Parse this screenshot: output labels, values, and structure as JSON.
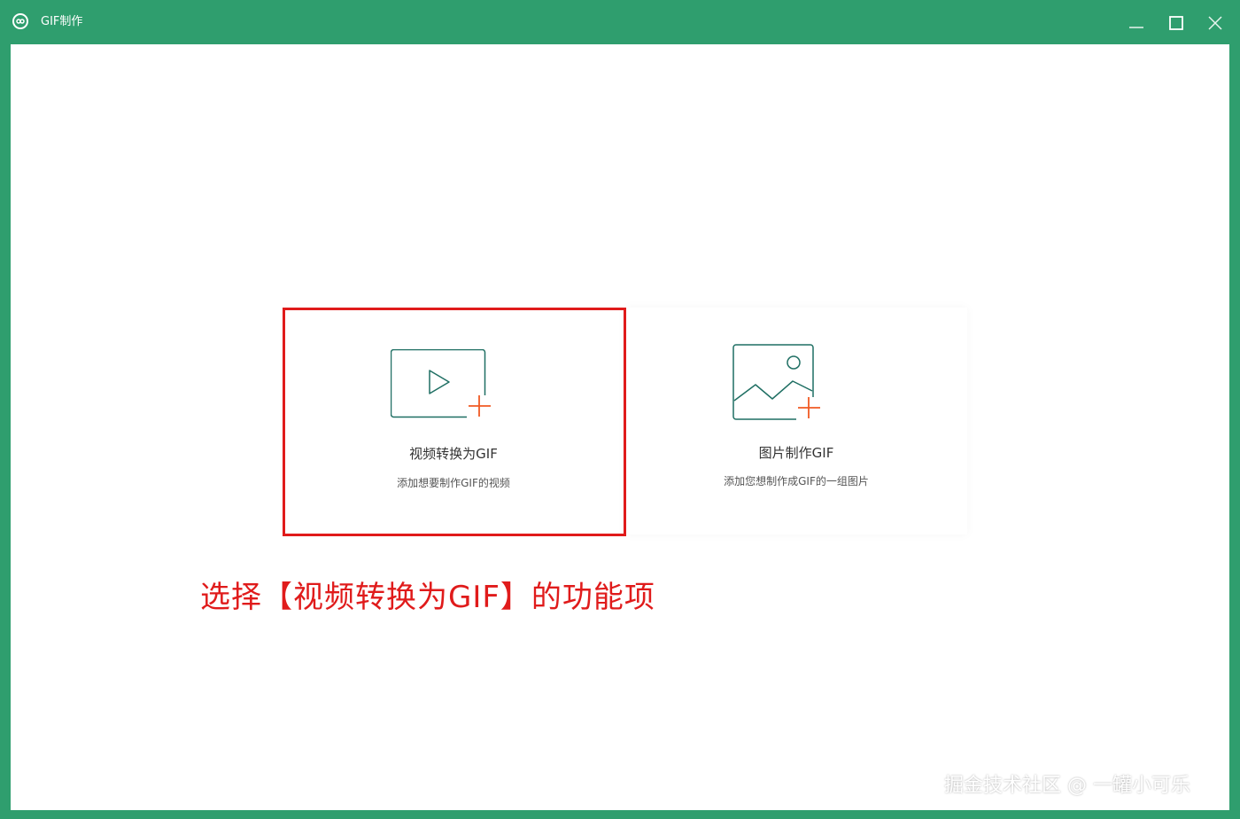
{
  "window": {
    "title": "GIF制作",
    "controls": {
      "minimize_icon": "minimize-icon",
      "maximize_icon": "maximize-icon",
      "close_icon": "close-icon"
    }
  },
  "cards": [
    {
      "title": "视频转换为GIF",
      "description": "添加想要制作GIF的视频",
      "icon": "video-add-icon"
    },
    {
      "title": "图片制作GIF",
      "description": "添加您想制作成GIF的一组图片",
      "icon": "image-add-icon"
    }
  ],
  "annotation": {
    "text": "选择【视频转换为GIF】的功能项"
  },
  "watermark": {
    "text": "掘金技术社区 @ 一罐小可乐"
  },
  "colors": {
    "titlebar": "#2f9e6e",
    "icon_stroke": "#1f6f63",
    "accent_plus": "#f05a23",
    "highlight": "#e01b1b"
  }
}
